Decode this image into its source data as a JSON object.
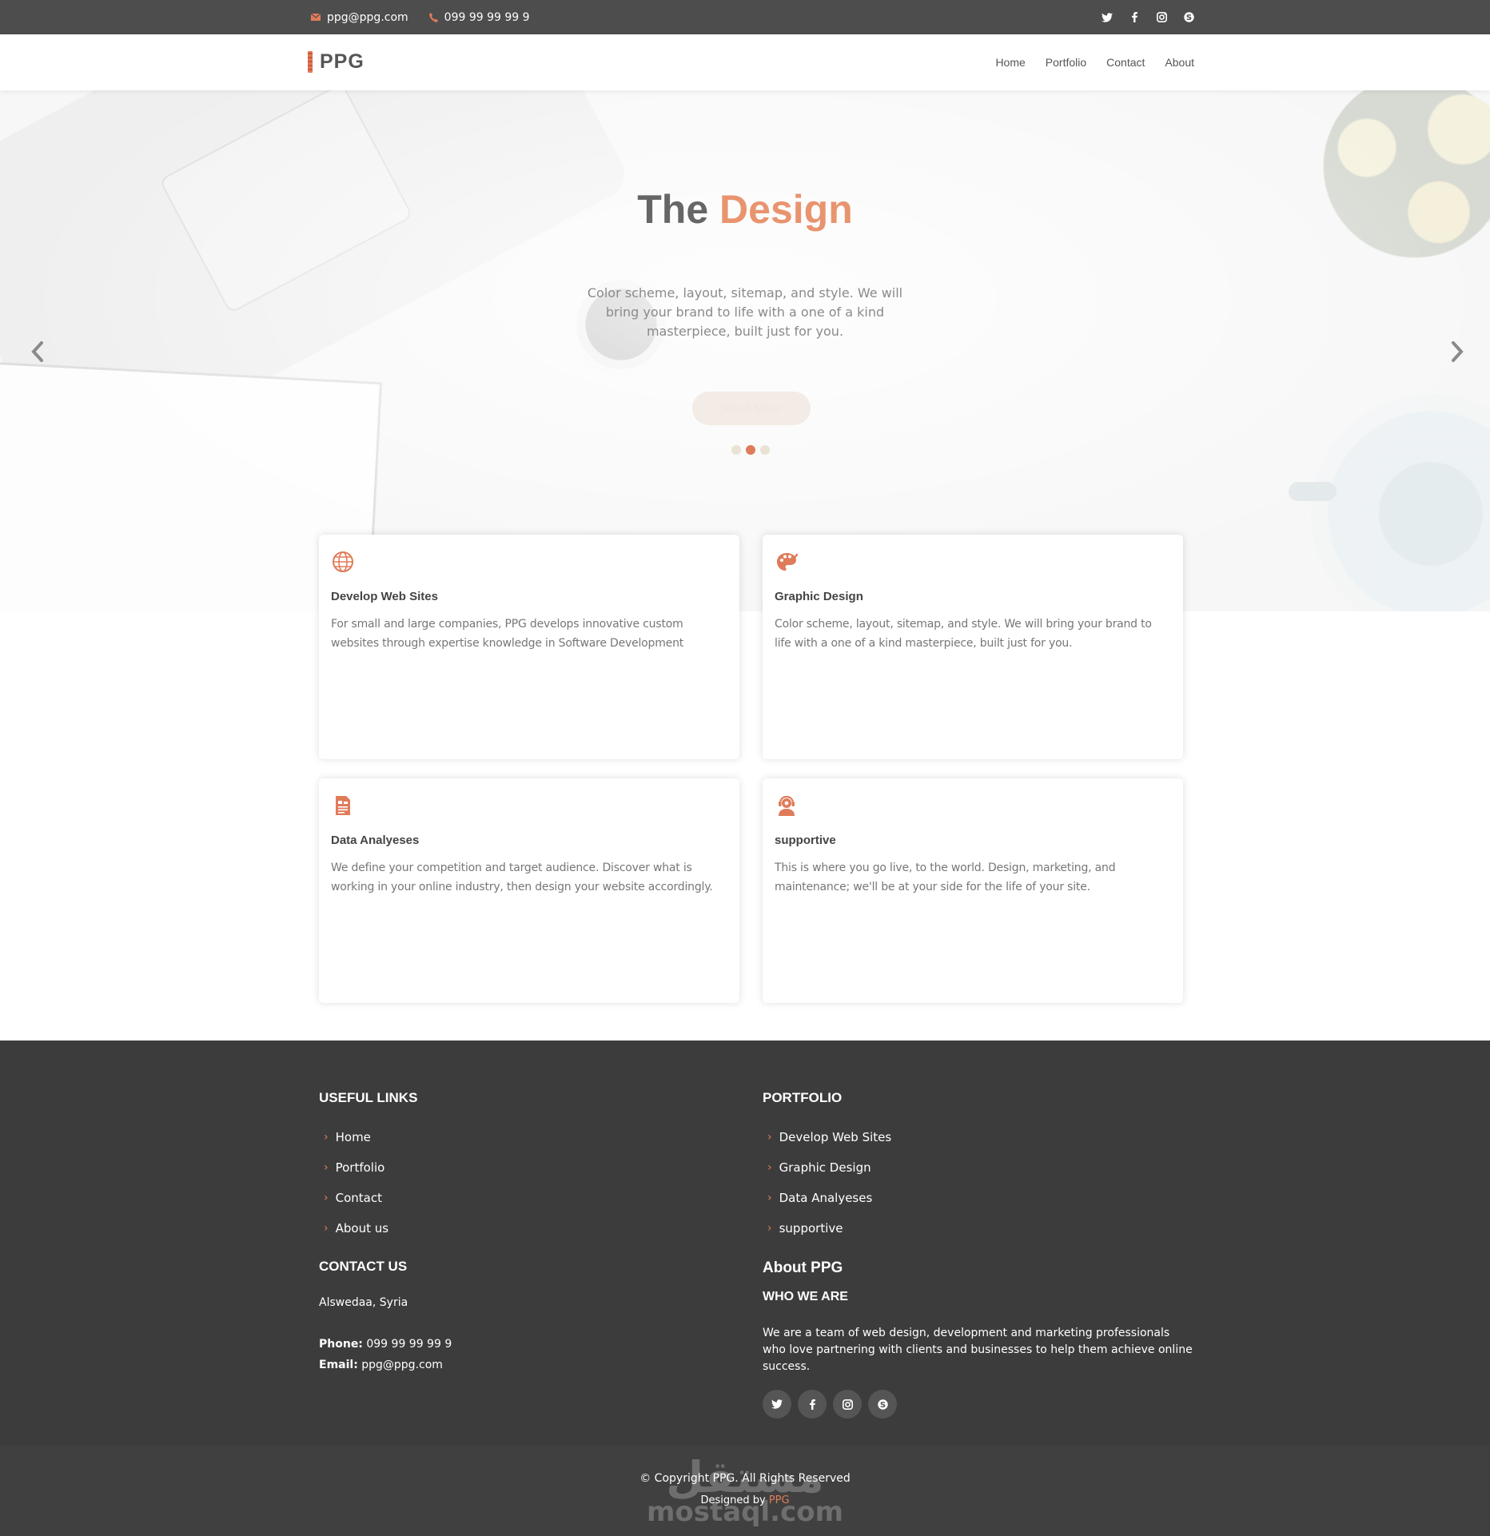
{
  "topbar": {
    "email": "ppg@ppg.com",
    "phone": "099 99 99 99 9",
    "social_icons": [
      "twitter-icon",
      "facebook-icon",
      "instagram-icon",
      "skype-icon"
    ]
  },
  "header": {
    "logo": "PPG",
    "nav": [
      "Home",
      "Portfolio",
      "Contact",
      "About"
    ]
  },
  "hero": {
    "title_main": "The",
    "title_accent": "Design",
    "subtitle": "Color scheme, layout, sitemap, and style. We will bring your brand to life with a one of a kind masterpiece, built just for you.",
    "button_label": "Read More",
    "slides_count": 3,
    "active_slide_index": 1
  },
  "services": [
    {
      "icon": "globe-icon",
      "title": "Develop Web Sites",
      "text": "For small and large companies, PPG develops innovative custom websites through expertise knowledge in Software Development"
    },
    {
      "icon": "palette-icon",
      "title": "Graphic Design",
      "text": "Color scheme, layout, sitemap, and style. We will bring your brand to life with a one of a kind masterpiece, built just for you."
    },
    {
      "icon": "document-chart-icon",
      "title": "Data Analyeses",
      "text": "We define your competition and target audience. Discover what is working in your online industry, then design your website accordingly."
    },
    {
      "icon": "support-agent-icon",
      "title": "supportive",
      "text": "This is where you go live, to the world. Design, marketing, and maintenance; we'll be at your side for the life of your site."
    }
  ],
  "footer": {
    "useful_links": {
      "heading": "USEFUL LINKS",
      "items": [
        "Home",
        "Portfolio",
        "Contact",
        "About us"
      ]
    },
    "portfolio": {
      "heading": "PORTFOLIO",
      "items": [
        "Develop Web Sites",
        "Graphic Design",
        "Data Analyeses",
        "supportive"
      ]
    },
    "contact": {
      "heading": "CONTACT US",
      "address": "Alswedaa, Syria",
      "phone_label": "Phone:",
      "phone": "099 99 99 99 9",
      "email_label": "Email:",
      "email": "ppg@ppg.com"
    },
    "about": {
      "heading": "About PPG",
      "subheading": "WHO WE ARE",
      "text": "We are a team of web design, development and marketing professionals who love partnering with clients and businesses to help them achieve online success."
    },
    "copyright": "© Copyright PPG. All Rights Reserved",
    "designed_by_label": "Designed by",
    "designed_by_name": "PPG",
    "watermark_arabic": "مستقل",
    "watermark_latin": "mostaql.com"
  },
  "colors": {
    "accent": "#e07b5a",
    "topbar": "#4d4d4d",
    "footer": "#3c3c3c",
    "bottom": "#404040"
  }
}
